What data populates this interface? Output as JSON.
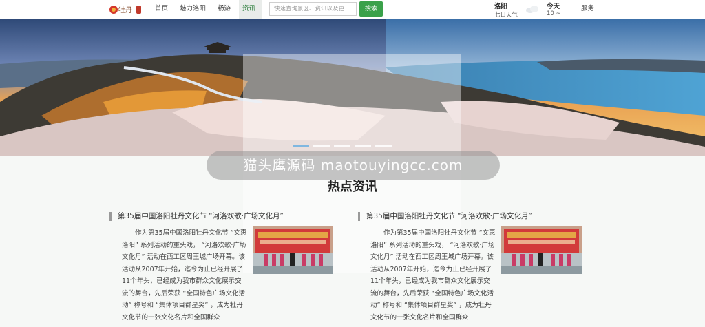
{
  "nav": {
    "items": [
      {
        "label": "首页",
        "active": false
      },
      {
        "label": "魅力洛阳",
        "active": false
      },
      {
        "label": "畅游",
        "active": false
      },
      {
        "label": "资讯",
        "active": true
      }
    ],
    "search_placeholder": "快速查询景区、资讯以及更",
    "search_button": "搜索",
    "weather": {
      "city": "洛阳",
      "desc": "七日天气",
      "day": "今天",
      "temp": "10 ~",
      "icon": "cloud-icon"
    },
    "service": "服务"
  },
  "logo": {
    "text": "牡丹",
    "icon": "peony-logo-icon"
  },
  "banner": {
    "slide_count": 5,
    "active_slide": 0
  },
  "watermark": "猫头鹰源码 maotouyingcc.com",
  "section_title": "热点资讯",
  "news": [
    {
      "title": "第35届中国洛阳牡丹文化节 “河洛欢歌·广场文化月”",
      "body": "作为第35届中国洛阳牡丹文化节 “文惠洛阳” 系列活动的重头戏， “河洛欢歌·广场文化月” 活动在西工区周王城广场开幕。该活动从2007年开始，迄今为止已经开展了11个年头，已经成为我市群众文化展示交流的舞台，先后荣获 “全国特色广场文化活动” 称号和 “集体项目群星奖” ，成为牡丹文化节的一张文化名片和全国群众"
    },
    {
      "title": "第35届中国洛阳牡丹文化节 “河洛欢歌·广场文化月”",
      "body": "作为第35届中国洛阳牡丹文化节 “文惠洛阳” 系列活动的重头戏， “河洛欢歌·广场文化月” 活动在西工区周王城广场开幕。该活动从2007年开始，迄今为止已经开展了11个年头，已经成为我市群众文化展示交流的舞台，先后荣获 “全国特色广场文化活动” 称号和 “集体项目群星奖” ，成为牡丹文化节的一张文化名片和全国群众"
    }
  ]
}
